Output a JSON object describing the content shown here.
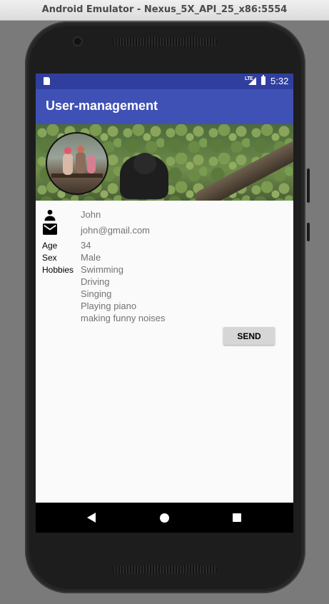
{
  "window": {
    "title": "Android Emulator - Nexus_5X_API_25_x86:5554"
  },
  "status_bar": {
    "network": "LTE",
    "time": "5:32"
  },
  "app_bar": {
    "title": "User-management"
  },
  "profile": {
    "name": "John",
    "email": "john@gmail.com",
    "age_label": "Age",
    "age": "34",
    "sex_label": "Sex",
    "sex": "Male",
    "hobbies_label": "Hobbies",
    "hobbies": [
      "Swimming",
      "Driving",
      "Singing",
      "Playing piano",
      "making funny noises"
    ]
  },
  "actions": {
    "send_label": "SEND"
  },
  "colors": {
    "status_bar": "#303f9f",
    "app_bar": "#3f51b5",
    "background": "#fafafa",
    "send_button": "#d6d6d6"
  },
  "icons": [
    "person-icon",
    "email-icon",
    "back-icon",
    "home-icon",
    "recents-icon"
  ]
}
